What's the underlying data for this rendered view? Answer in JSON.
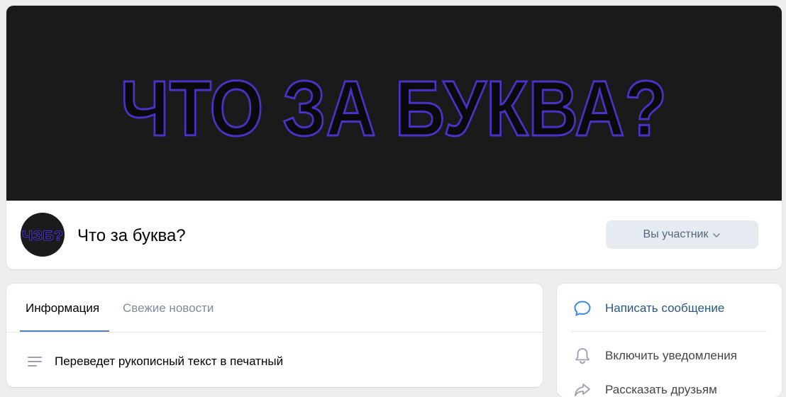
{
  "cover": {
    "headline": "ЧТО ЗА БУКВА?",
    "background_color": "#1a1a1a",
    "text_fill_color": "#0a0a0a",
    "text_outline_color": "#4a32c8"
  },
  "community": {
    "avatar_text": "ЧЗБ?",
    "name": "Что за буква?"
  },
  "membership": {
    "button_label": "Вы участник",
    "icon": "chevron-down-icon"
  },
  "tabs": [
    {
      "label": "Информация",
      "active": true
    },
    {
      "label": "Свежие новости",
      "active": false
    }
  ],
  "info": {
    "description": "Переведет рукописный текст в печатный",
    "icon": "text-lines-icon"
  },
  "actions": [
    {
      "label": "Написать сообщение",
      "icon": "message-bubble-icon"
    },
    {
      "label": "Включить уведомления",
      "icon": "bell-icon"
    },
    {
      "label": "Рассказать друзьям",
      "icon": "share-icon"
    }
  ],
  "colors": {
    "page_bg": "#edeef0",
    "accent": "#5181b8",
    "link": "#2a5885",
    "muted": "#818c99",
    "button_bg": "#e5ebf1",
    "button_text": "#55677d"
  }
}
